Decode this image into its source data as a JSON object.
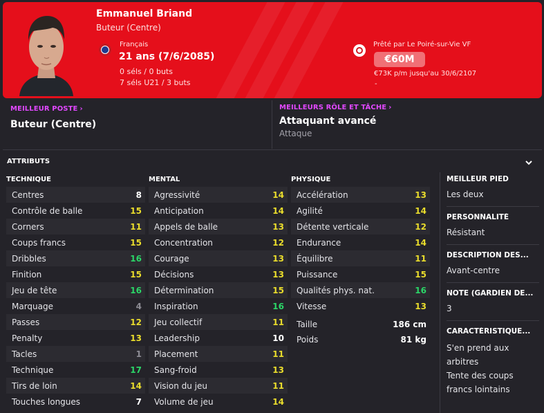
{
  "player": {
    "name": "Emmanuel Briand",
    "position": "Buteur (Centre)",
    "nationality": "Français",
    "age": "21 ans (7/6/2085)",
    "caps": "0 séls / 0 buts",
    "u21_caps": "7 séls U21 / 3 buts"
  },
  "contract": {
    "loan": "Prêté par Le Poiré-sur-Vie VF",
    "value": "€60M",
    "wage": "€73K p/m jusqu'au 30/6/2107",
    "extra": "-"
  },
  "colors": {
    "hero": "#e50f1b",
    "accent": "#e148ff",
    "high": "#2bd567",
    "good": "#e9dc2c"
  },
  "roles": {
    "best_position_label": "MEILLEUR POSTE",
    "best_position": "Buteur (Centre)",
    "best_role_label": "MEILLEURS RÔLE ET TÂCHE",
    "best_role": "Attaquant avancé",
    "best_duty": "Attaque"
  },
  "attributes": {
    "title": "ATTRIBUTS",
    "technical": {
      "header": "TECHNIQUE",
      "items": [
        {
          "name": "Centres",
          "value": "8"
        },
        {
          "name": "Contrôle de balle",
          "value": "15"
        },
        {
          "name": "Corners",
          "value": "11"
        },
        {
          "name": "Coups francs",
          "value": "15"
        },
        {
          "name": "Dribbles",
          "value": "16"
        },
        {
          "name": "Finition",
          "value": "15"
        },
        {
          "name": "Jeu de tête",
          "value": "16"
        },
        {
          "name": "Marquage",
          "value": "4"
        },
        {
          "name": "Passes",
          "value": "12"
        },
        {
          "name": "Penalty",
          "value": "13"
        },
        {
          "name": "Tacles",
          "value": "1"
        },
        {
          "name": "Technique",
          "value": "17"
        },
        {
          "name": "Tirs de loin",
          "value": "14"
        },
        {
          "name": "Touches longues",
          "value": "7"
        }
      ]
    },
    "mental": {
      "header": "MENTAL",
      "items": [
        {
          "name": "Agressivité",
          "value": "14"
        },
        {
          "name": "Anticipation",
          "value": "14"
        },
        {
          "name": "Appels de balle",
          "value": "13"
        },
        {
          "name": "Concentration",
          "value": "12"
        },
        {
          "name": "Courage",
          "value": "13"
        },
        {
          "name": "Décisions",
          "value": "13"
        },
        {
          "name": "Détermination",
          "value": "15"
        },
        {
          "name": "Inspiration",
          "value": "16"
        },
        {
          "name": "Jeu collectif",
          "value": "11"
        },
        {
          "name": "Leadership",
          "value": "10"
        },
        {
          "name": "Placement",
          "value": "11"
        },
        {
          "name": "Sang-froid",
          "value": "13"
        },
        {
          "name": "Vision du jeu",
          "value": "11"
        },
        {
          "name": "Volume de jeu",
          "value": "14"
        }
      ]
    },
    "physical": {
      "header": "PHYSIQUE",
      "items": [
        {
          "name": "Accélération",
          "value": "13"
        },
        {
          "name": "Agilité",
          "value": "14"
        },
        {
          "name": "Détente verticale",
          "value": "12"
        },
        {
          "name": "Endurance",
          "value": "14"
        },
        {
          "name": "Équilibre",
          "value": "11"
        },
        {
          "name": "Puissance",
          "value": "15"
        },
        {
          "name": "Qualités phys. nat.",
          "value": "16"
        },
        {
          "name": "Vitesse",
          "value": "13"
        }
      ],
      "height_label": "Taille",
      "height": "186 cm",
      "weight_label": "Poids",
      "weight": "81 kg"
    }
  },
  "side": {
    "foot_label": "MEILLEUR PIED",
    "foot": "Les deux",
    "personality_label": "PERSONNALITÉ",
    "personality": "Résistant",
    "media_label": "DESCRIPTION DES...",
    "media": "Avant-centre",
    "gk_label": "NOTE (GARDIEN DE...",
    "gk": "3",
    "traits_label": "CARACTÉRISTIQUE...",
    "trait1": "S'en prend aux arbitres",
    "trait2": "Tente des coups francs lointains"
  }
}
